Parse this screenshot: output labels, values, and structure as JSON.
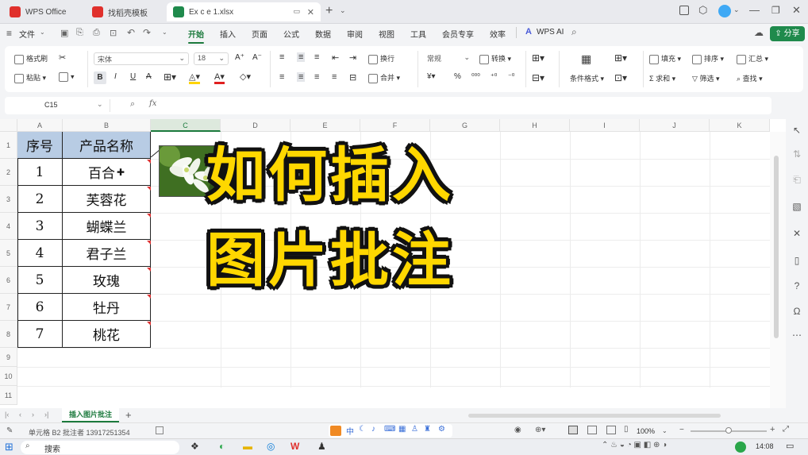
{
  "tabs": [
    {
      "label": "WPS Office",
      "color": "#e0302c"
    },
    {
      "label": "找稻壳模板",
      "color": "#e0302c"
    },
    {
      "label": "Ex c e 1.xlsx",
      "color": "#1f8a4c"
    }
  ],
  "menu": {
    "file": "文件",
    "items": [
      "开始",
      "插入",
      "页面",
      "公式",
      "数据",
      "审阅",
      "视图",
      "工具",
      "会员专享",
      "效率"
    ],
    "active": "开始",
    "wps_ai": "WPS AI",
    "share": "分享"
  },
  "ribbon": {
    "format_painter": "格式刷",
    "paste": "粘贴",
    "font_name": "宋体",
    "font_size": "18",
    "wrap": "换行",
    "merge": "合并",
    "number_format": "常规",
    "convert": "转换",
    "cond_format": "条件格式",
    "fill": "填充",
    "sort": "排序",
    "summary": "汇总",
    "autosum": "求和",
    "filter": "筛选",
    "find": "查找"
  },
  "formula_bar": {
    "name_box": "C15",
    "fx": "fx",
    "value": ""
  },
  "columns": [
    "A",
    "B",
    "C",
    "D",
    "E",
    "F",
    "G",
    "H",
    "I",
    "J",
    "K"
  ],
  "rows": [
    "1",
    "2",
    "3",
    "4",
    "5",
    "6",
    "7",
    "8",
    "9",
    "10",
    "11"
  ],
  "table": {
    "headers": [
      "序号",
      "产品名称"
    ],
    "rows": [
      [
        "1",
        "百合"
      ],
      [
        "2",
        "芙蓉花"
      ],
      [
        "3",
        "蝴蝶兰"
      ],
      [
        "4",
        "君子兰"
      ],
      [
        "5",
        "玫瑰"
      ],
      [
        "6",
        "牡丹"
      ],
      [
        "7",
        "桃花"
      ]
    ],
    "header_fill": "#b8cce4"
  },
  "overlay": {
    "line1": "如何插入",
    "line2": "图片批注",
    "color": "#ffd700"
  },
  "sheet_tab": "插入图片批注",
  "status": {
    "text": "单元格 B2 批注者 13917251354",
    "zoom": "100%"
  },
  "taskbar": {
    "search": "搜索",
    "time": "14:08"
  }
}
